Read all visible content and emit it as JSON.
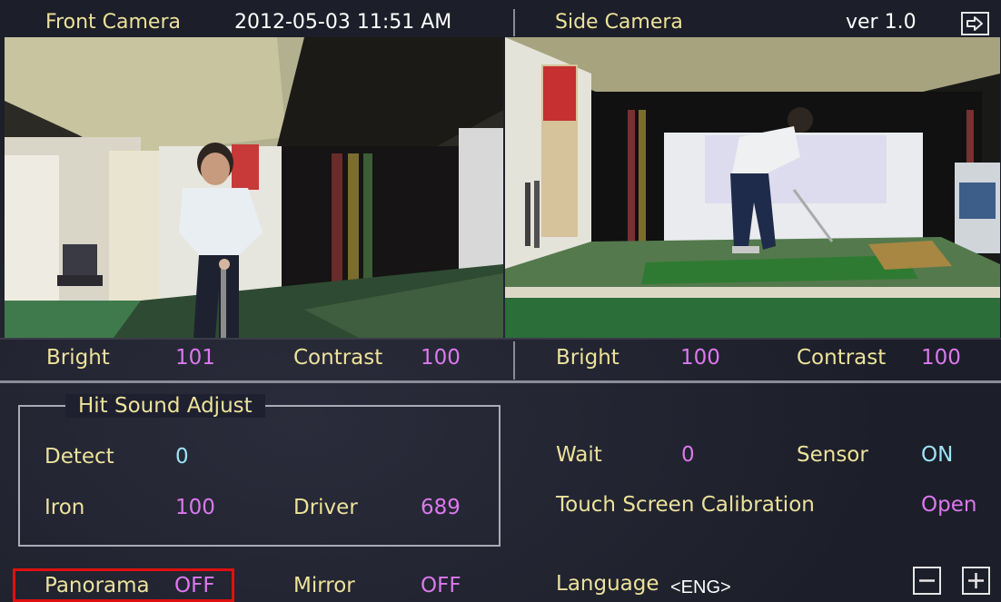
{
  "header": {
    "front_title": "Front Camera",
    "datetime": "2012-05-03 11:51 AM",
    "side_title": "Side Camera",
    "version": "ver 1.0"
  },
  "front_adjust": {
    "bright_label": "Bright",
    "bright_value": "101",
    "contrast_label": "Contrast",
    "contrast_value": "100"
  },
  "side_adjust": {
    "bright_label": "Bright",
    "bright_value": "100",
    "contrast_label": "Contrast",
    "contrast_value": "100"
  },
  "hit_sound": {
    "title": "Hit Sound Adjust",
    "detect_label": "Detect",
    "detect_value": "0",
    "iron_label": "Iron",
    "iron_value": "100",
    "driver_label": "Driver",
    "driver_value": "689"
  },
  "right_settings": {
    "wait_label": "Wait",
    "wait_value": "0",
    "sensor_label": "Sensor",
    "sensor_value": "ON",
    "calibration_label": "Touch Screen Calibration",
    "calibration_value": "Open"
  },
  "bottom": {
    "panorama_label": "Panorama",
    "panorama_value": "OFF",
    "mirror_label": "Mirror",
    "mirror_value": "OFF",
    "language_label": "Language",
    "language_value": "<ENG>"
  },
  "icons": {
    "exit": "exit-icon",
    "minus": "minus-icon",
    "plus": "plus-icon"
  },
  "colors": {
    "label_yellow": "#ece29b",
    "value_magenta": "#dc78ee",
    "value_cyan": "#9be4f4",
    "highlight_red": "#e01010",
    "background": "#1c1e29"
  }
}
